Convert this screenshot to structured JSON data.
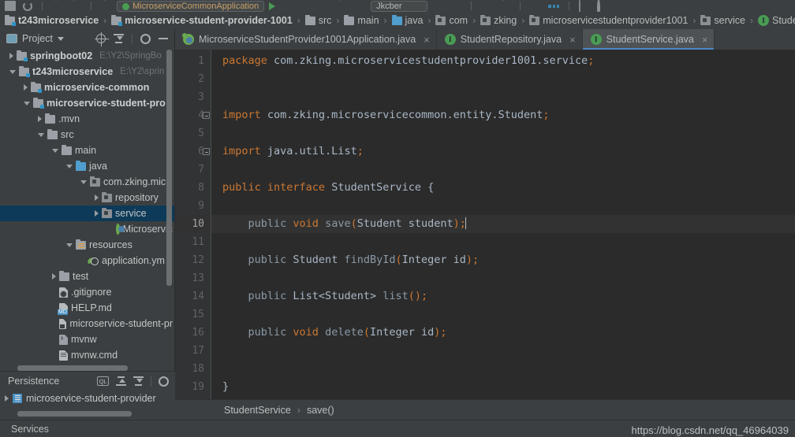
{
  "toolbar": {
    "run_config": "MicroserviceCommonApplication",
    "search_box": "Jkcber",
    "icons": [
      "save-icon",
      "sync-icon",
      "back-icon",
      "forward-icon",
      "update-project-icon",
      "run-icon",
      "debug-icon",
      "run-with-coverage-icon",
      "profile-icon",
      "stop-icon",
      "commit-icon",
      "structure-icon",
      "settings-icon",
      "search-everywhere-icon"
    ]
  },
  "navbar": {
    "crumbs": [
      {
        "label": "t243microservice",
        "icon": "module-icon",
        "bold": true
      },
      {
        "label": "microservice-student-provider-1001",
        "icon": "module-icon",
        "bold": true
      },
      {
        "label": "src",
        "icon": "folder-icon",
        "bold": false
      },
      {
        "label": "main",
        "icon": "folder-icon",
        "bold": false
      },
      {
        "label": "java",
        "icon": "folder-blue-icon",
        "bold": false
      },
      {
        "label": "com",
        "icon": "package-icon",
        "bold": false
      },
      {
        "label": "zking",
        "icon": "package-icon",
        "bold": false
      },
      {
        "label": "microservicestudentprovider1001",
        "icon": "package-icon",
        "bold": false
      },
      {
        "label": "service",
        "icon": "package-icon",
        "bold": false
      },
      {
        "label": "Stude",
        "icon": "interface-icon",
        "bold": false
      }
    ]
  },
  "sidebar": {
    "title": "Project",
    "actions": [
      "locate-icon",
      "collapse-all-icon",
      "expand-all-icon",
      "gear-icon",
      "minimize-icon"
    ],
    "tree": [
      {
        "label": "springboot02",
        "path": "E:\\Y2\\SpringBo",
        "indent": 8,
        "arrow": "right",
        "icon": "module-icon",
        "bold": true,
        "selected": false
      },
      {
        "label": "t243microservice",
        "path": "E:\\Y2\\sprin",
        "indent": 8,
        "arrow": "down",
        "icon": "module-icon",
        "bold": true,
        "selected": false
      },
      {
        "label": "microservice-common",
        "path": "",
        "indent": 26,
        "arrow": "right",
        "icon": "module-icon",
        "bold": true,
        "selected": false
      },
      {
        "label": "microservice-student-pro",
        "path": "",
        "indent": 26,
        "arrow": "down",
        "icon": "module-icon",
        "bold": true,
        "selected": false
      },
      {
        "label": ".mvn",
        "path": "",
        "indent": 44,
        "arrow": "right",
        "icon": "folder-icon",
        "bold": false,
        "selected": false
      },
      {
        "label": "src",
        "path": "",
        "indent": 44,
        "arrow": "down",
        "icon": "folder-icon",
        "bold": false,
        "selected": false
      },
      {
        "label": "main",
        "path": "",
        "indent": 62,
        "arrow": "down",
        "icon": "folder-icon",
        "bold": false,
        "selected": false
      },
      {
        "label": "java",
        "path": "",
        "indent": 80,
        "arrow": "down",
        "icon": "folder-blue-icon",
        "bold": false,
        "selected": false
      },
      {
        "label": "com.zking.mic",
        "path": "",
        "indent": 98,
        "arrow": "down",
        "icon": "package-icon",
        "bold": false,
        "selected": false
      },
      {
        "label": "repository",
        "path": "",
        "indent": 116,
        "arrow": "right",
        "icon": "package-icon",
        "bold": false,
        "selected": false
      },
      {
        "label": "service",
        "path": "",
        "indent": 116,
        "arrow": "right",
        "icon": "package-icon",
        "bold": false,
        "selected": true
      },
      {
        "label": "Microservic",
        "path": "",
        "indent": 134,
        "arrow": "none",
        "icon": "spring-class-icon",
        "bold": false,
        "selected": false
      },
      {
        "label": "resources",
        "path": "",
        "indent": 80,
        "arrow": "down",
        "icon": "resources-icon",
        "bold": false,
        "selected": false
      },
      {
        "label": "application.ym",
        "path": "",
        "indent": 98,
        "arrow": "none",
        "icon": "yaml-icon",
        "bold": false,
        "selected": false
      },
      {
        "label": "test",
        "path": "",
        "indent": 62,
        "arrow": "right",
        "icon": "folder-icon",
        "bold": false,
        "selected": false
      },
      {
        "label": ".gitignore",
        "path": "",
        "indent": 62,
        "arrow": "none",
        "icon": "gitignore-icon",
        "bold": false,
        "selected": false
      },
      {
        "label": "HELP.md",
        "path": "",
        "indent": 62,
        "arrow": "none",
        "icon": "markdown-icon",
        "bold": false,
        "selected": false
      },
      {
        "label": "microservice-student-pr",
        "path": "",
        "indent": 62,
        "arrow": "none",
        "icon": "xml-icon",
        "bold": false,
        "selected": false
      },
      {
        "label": "mvnw",
        "path": "",
        "indent": 62,
        "arrow": "none",
        "icon": "shell-icon",
        "bold": false,
        "selected": false
      },
      {
        "label": "mvnw.cmd",
        "path": "",
        "indent": 62,
        "arrow": "none",
        "icon": "cmd-icon",
        "bold": false,
        "selected": false
      }
    ]
  },
  "persistence": {
    "title": "Persistence",
    "actions": [
      "ql-console-icon",
      "expand-all-icon",
      "collapse-all-icon",
      "gear-icon"
    ],
    "items": [
      {
        "label": "microservice-student-provider",
        "arrow": "right",
        "icon": "persistence-unit-icon"
      }
    ]
  },
  "editor": {
    "tabs": [
      {
        "label": "MicroserviceStudentProvider1001Application.java",
        "icon": "spring-boot-icon",
        "active": false,
        "close": "×"
      },
      {
        "label": "StudentRepository.java",
        "icon": "interface-icon",
        "active": false,
        "close": "×"
      },
      {
        "label": "StudentService.java",
        "icon": "interface-icon",
        "active": true,
        "close": "×"
      }
    ],
    "lines": [
      {
        "n": 1,
        "current": false,
        "fold": false,
        "tokens": [
          {
            "t": "package ",
            "c": "kw"
          },
          {
            "t": "com.zking.microservicestudentprovider1001.service",
            "c": "pl"
          },
          {
            "t": ";",
            "c": "semi"
          }
        ]
      },
      {
        "n": 2,
        "current": false,
        "fold": false,
        "tokens": []
      },
      {
        "n": 3,
        "current": false,
        "fold": false,
        "tokens": []
      },
      {
        "n": 4,
        "current": false,
        "fold": true,
        "tokens": [
          {
            "t": "import ",
            "c": "kw"
          },
          {
            "t": "com.zking.microservicecommon.entity.Student",
            "c": "pl"
          },
          {
            "t": ";",
            "c": "semi"
          }
        ]
      },
      {
        "n": 5,
        "current": false,
        "fold": false,
        "tokens": []
      },
      {
        "n": 6,
        "current": false,
        "fold": true,
        "tokens": [
          {
            "t": "import ",
            "c": "kw"
          },
          {
            "t": "java.util.List",
            "c": "pl"
          },
          {
            "t": ";",
            "c": "semi"
          }
        ]
      },
      {
        "n": 7,
        "current": false,
        "fold": false,
        "tokens": []
      },
      {
        "n": 8,
        "current": false,
        "fold": false,
        "tokens": [
          {
            "t": "public ",
            "c": "kw"
          },
          {
            "t": "interface ",
            "c": "kw"
          },
          {
            "t": "StudentService ",
            "c": "cls"
          },
          {
            "t": "{",
            "c": "pl"
          }
        ]
      },
      {
        "n": 9,
        "current": false,
        "fold": false,
        "tokens": []
      },
      {
        "n": 10,
        "current": true,
        "fold": false,
        "tokens": [
          {
            "t": "    ",
            "c": "pl"
          },
          {
            "t": "public ",
            "c": "mth"
          },
          {
            "t": "void ",
            "c": "kw"
          },
          {
            "t": "save",
            "c": "mth"
          },
          {
            "t": "(",
            "c": "semi"
          },
          {
            "t": "Student student",
            "c": "cls"
          },
          {
            "t": ")",
            "c": "semi"
          },
          {
            "t": ";",
            "c": "semi"
          }
        ],
        "caret": true
      },
      {
        "n": 11,
        "current": false,
        "fold": false,
        "tokens": []
      },
      {
        "n": 12,
        "current": false,
        "fold": false,
        "tokens": [
          {
            "t": "    ",
            "c": "pl"
          },
          {
            "t": "public ",
            "c": "mth"
          },
          {
            "t": "Student ",
            "c": "cls"
          },
          {
            "t": "findById",
            "c": "mth"
          },
          {
            "t": "(",
            "c": "semi"
          },
          {
            "t": "Integer id",
            "c": "cls"
          },
          {
            "t": ")",
            "c": "semi"
          },
          {
            "t": ";",
            "c": "semi"
          }
        ]
      },
      {
        "n": 13,
        "current": false,
        "fold": false,
        "tokens": []
      },
      {
        "n": 14,
        "current": false,
        "fold": false,
        "tokens": [
          {
            "t": "    ",
            "c": "pl"
          },
          {
            "t": "public ",
            "c": "mth"
          },
          {
            "t": "List<Student> ",
            "c": "cls"
          },
          {
            "t": "list",
            "c": "mth"
          },
          {
            "t": "()",
            "c": "semi"
          },
          {
            "t": ";",
            "c": "semi"
          }
        ]
      },
      {
        "n": 15,
        "current": false,
        "fold": false,
        "tokens": []
      },
      {
        "n": 16,
        "current": false,
        "fold": false,
        "tokens": [
          {
            "t": "    ",
            "c": "pl"
          },
          {
            "t": "public ",
            "c": "mth"
          },
          {
            "t": "void ",
            "c": "kw"
          },
          {
            "t": "delete",
            "c": "mth"
          },
          {
            "t": "(",
            "c": "semi"
          },
          {
            "t": "Integer id",
            "c": "cls"
          },
          {
            "t": ")",
            "c": "semi"
          },
          {
            "t": ";",
            "c": "semi"
          }
        ]
      },
      {
        "n": 17,
        "current": false,
        "fold": false,
        "tokens": []
      },
      {
        "n": 18,
        "current": false,
        "fold": false,
        "tokens": []
      },
      {
        "n": 19,
        "current": false,
        "fold": false,
        "tokens": [
          {
            "t": "}",
            "c": "pl"
          }
        ]
      }
    ],
    "breadcrumb": [
      {
        "label": "StudentService"
      },
      {
        "label": "save()"
      }
    ],
    "breadcrumb_sep": "›"
  },
  "statusbar": {
    "label": "Services"
  },
  "watermark": "https://blog.csdn.net/qq_46964039",
  "colors": {
    "accent": "#4a88c7",
    "selection": "#0d3a58",
    "keyword": "#cc7832",
    "editor_bg": "#2b2b2b",
    "panel_bg": "#3c3f41",
    "gutter_bg": "#313335",
    "interface_green": "#499c54"
  }
}
